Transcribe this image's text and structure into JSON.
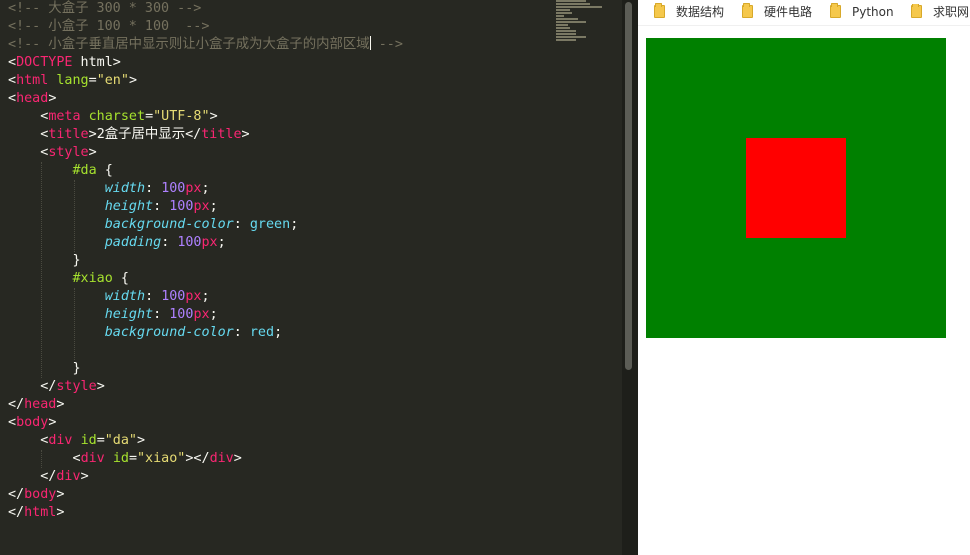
{
  "editor": {
    "lines": {
      "comment_big": "<!-- 大盒子 300 * 300 -->",
      "comment_small": "<!-- 小盒子 100 * 100  -->",
      "comment_center_text": "<!-- 小盒子垂直居中显示则让小盒子成为大盒子的内部区域",
      "comment_center_end": " -->",
      "doctype_open": "<!",
      "doctype_kw": "DOCTYPE",
      "doctype_rest": " html>",
      "lang_attr": "lang",
      "lang_val": "\"en\"",
      "charset_attr": "charset",
      "charset_val": "\"UTF-8\"",
      "title_text": "2盒子居中显示",
      "da_selector": "#da",
      "xiao_selector": "#xiao",
      "width_prop": "width",
      "height_prop": "height",
      "bg_prop": "background-color",
      "padding_prop": "padding",
      "val_100": "100",
      "unit_px": "px",
      "color_green": "green",
      "color_red": "red",
      "id_attr": "id",
      "id_da": "\"da\"",
      "id_xiao": "\"xiao\"",
      "tag_html": "html",
      "tag_head": "head",
      "tag_meta": "meta",
      "tag_title": "title",
      "tag_style": "style",
      "tag_body": "body",
      "tag_div": "div"
    }
  },
  "browser": {
    "bookmarks": [
      {
        "label": "数据结构",
        "icon": "folder-icon"
      },
      {
        "label": "硬件电路",
        "icon": "folder-icon"
      },
      {
        "label": "Python",
        "icon": "folder-icon"
      },
      {
        "label": "求职网",
        "icon": "folder-icon"
      }
    ],
    "colors": {
      "outer_box": "#008000",
      "inner_box": "#ff0000"
    }
  },
  "colors": {
    "editor_bg": "#272822",
    "comment": "#75715e",
    "tag": "#f92672",
    "attr": "#a6e22e",
    "string": "#e6db74",
    "property": "#66d9ef",
    "number": "#ae81ff"
  }
}
